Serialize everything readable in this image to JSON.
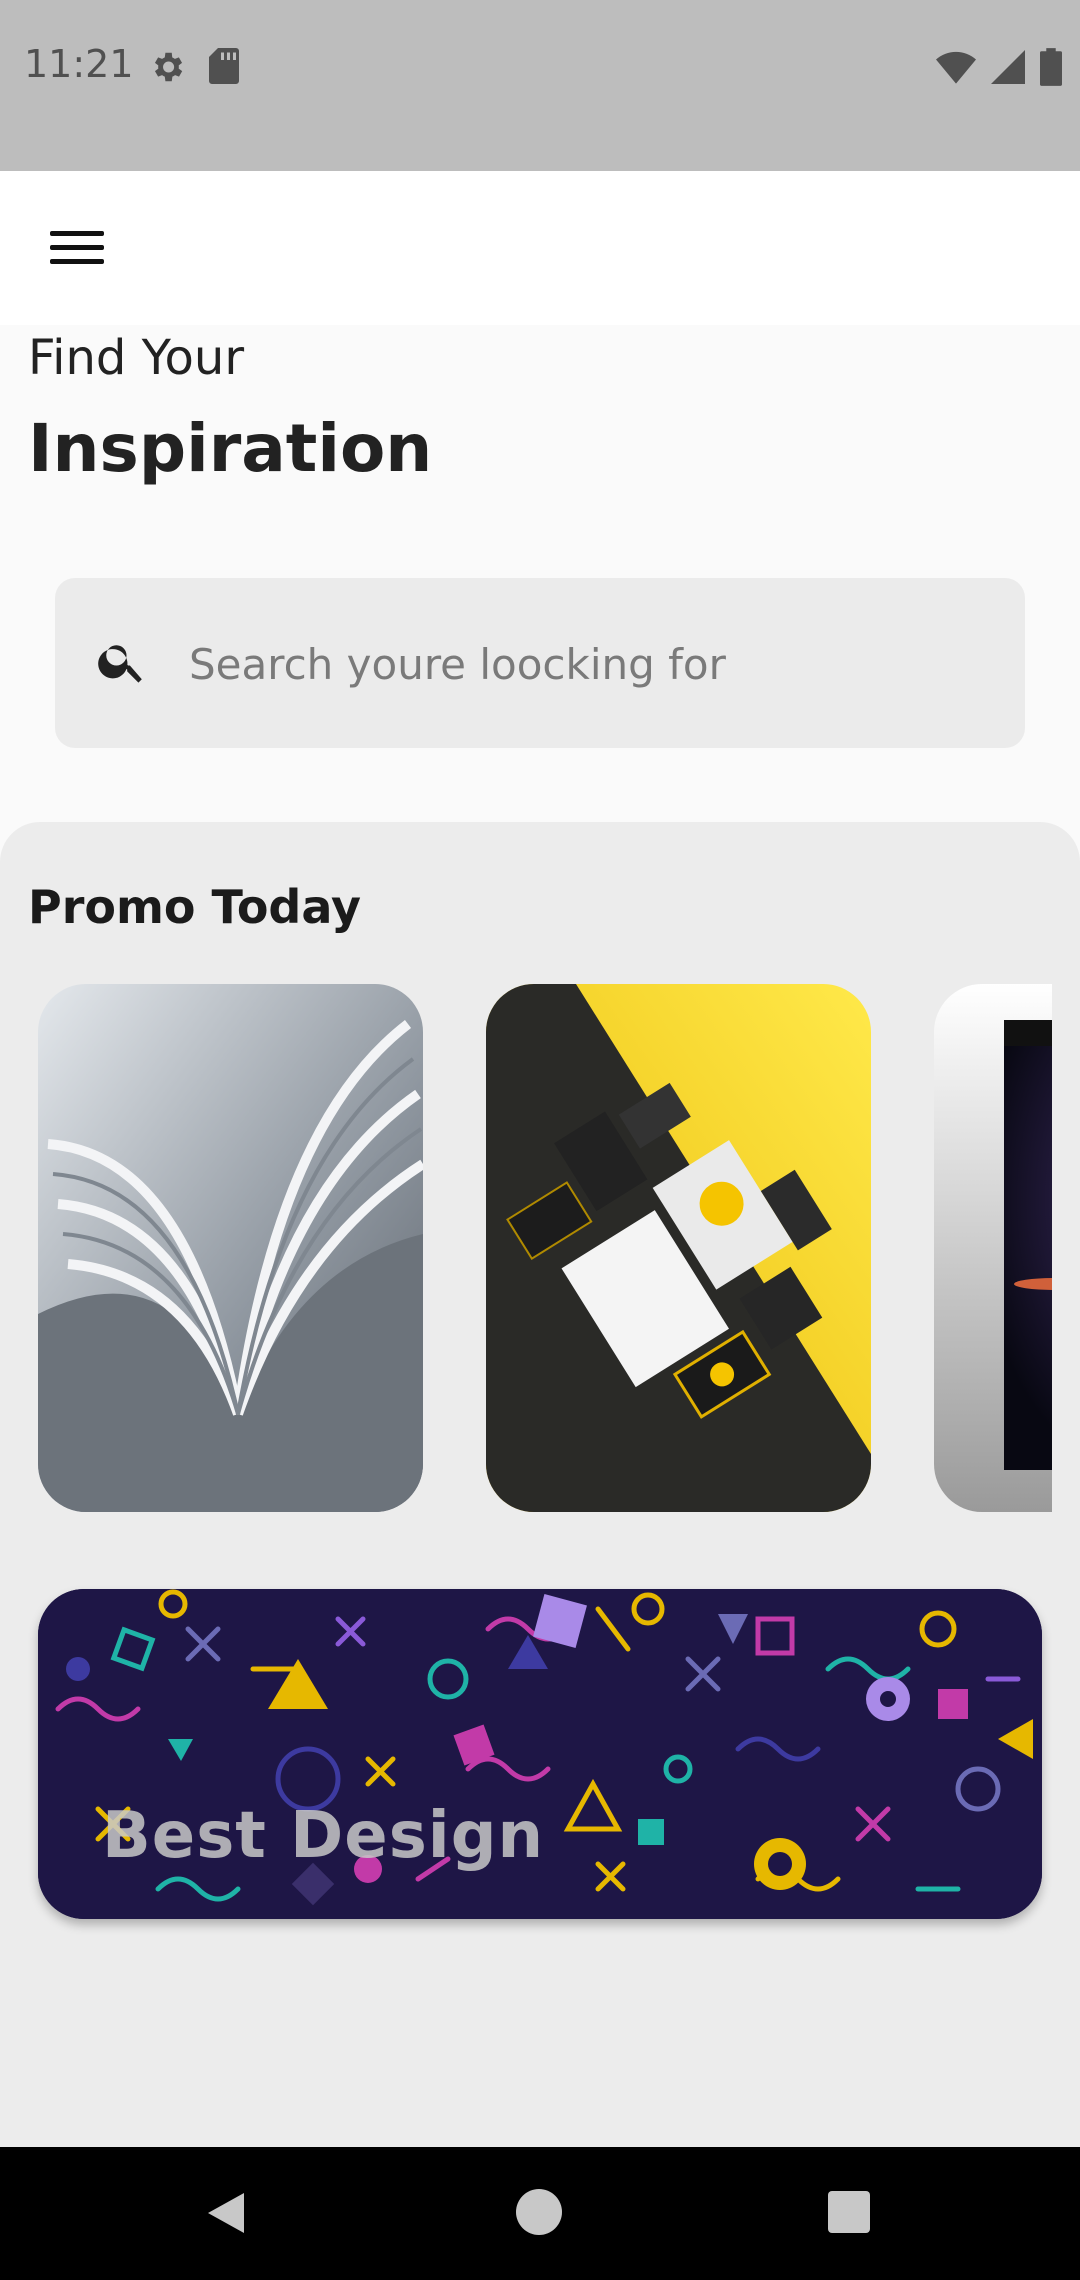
{
  "status_bar": {
    "time": "11:21",
    "left_icons": [
      "gear-icon",
      "sd-card-icon"
    ],
    "right_icons": [
      "wifi-icon",
      "signal-icon",
      "battery-icon"
    ]
  },
  "app_bar": {
    "menu_icon": "hamburger-menu-icon"
  },
  "heading": {
    "line1": "Find Your",
    "line2": "Inspiration"
  },
  "search": {
    "icon": "search-icon",
    "placeholder": "Search youre loocking for"
  },
  "promo": {
    "title": "Promo Today",
    "cards": [
      {
        "image": "magazines-photo"
      },
      {
        "image": "yellow-branding-photo"
      },
      {
        "image": "book-cover-photo"
      }
    ]
  },
  "banner": {
    "label": "Best Design"
  },
  "nav": {
    "back": "back-icon",
    "home": "home-icon",
    "recents": "recents-icon"
  },
  "colors": {
    "status_bar": "#bdbdbd",
    "panel": "#ececec",
    "banner_bg": "#1c1540",
    "yellow": "#f5c400"
  }
}
